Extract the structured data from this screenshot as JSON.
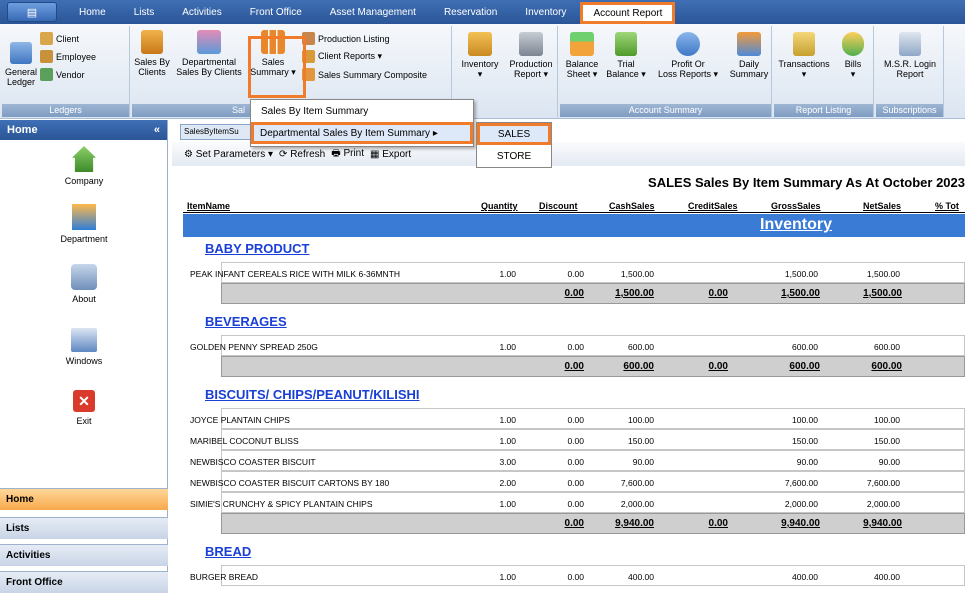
{
  "menubar": {
    "tabs": [
      "Home",
      "Lists",
      "Activities",
      "Front Office",
      "Asset Management",
      "Reservation",
      "Inventory"
    ],
    "active_tab": "Account Report"
  },
  "ribbon": {
    "ledgers": {
      "title": "Ledgers",
      "general": "General\nLedger",
      "client": "Client",
      "employee": "Employee",
      "vendor": "Vendor"
    },
    "sales": {
      "title": "Sal",
      "sales_by_clients": "Sales By\nClients",
      "departmental": "Departmental\nSales By Clients",
      "sales_summary": "Sales\nSummary ▾",
      "production_listing": "Production Listing",
      "client_reports": "Client Reports ▾",
      "sales_summary_composite": "Sales Summary Composite"
    },
    "inventory": {
      "inventory": "Inventory\n▾",
      "production": "Production\nReport ▾"
    },
    "account_summary": {
      "title": "Account Summary",
      "balance": "Balance\nSheet ▾",
      "trial": "Trial\nBalance ▾",
      "profit": "Profit Or\nLoss Reports ▾",
      "daily": "Daily\nSummary"
    },
    "report_listing": {
      "title": "Report Listing",
      "transactions": "Transactions\n▾",
      "bills": "Bills\n▾"
    },
    "subscriptions": {
      "title": "Subscriptions",
      "msr": "M.S.R. Login\nReport"
    }
  },
  "sidebar": {
    "title": "Home",
    "collapse": "«",
    "items": [
      "Company",
      "Department",
      "About",
      "Windows",
      "Exit"
    ],
    "nav": [
      "Home",
      "Lists",
      "Activities",
      "Front Office"
    ]
  },
  "doc": {
    "tab": "SalesByItemSu",
    "toolbar": {
      "set_parameters": "Set Parameters ▾",
      "refresh": "Refresh",
      "print": "Print",
      "export": "Export"
    }
  },
  "dropdown": {
    "items": [
      "Sales By Item Summary",
      "Departmental Sales By Item Summary  ▸"
    ]
  },
  "submenu": {
    "items": [
      "SALES",
      "STORE"
    ]
  },
  "report": {
    "title": "SALES Sales By Item Summary As At October 2023",
    "columns": [
      "ItemName",
      "Quantity",
      "Discount",
      "CashSales",
      "CreditSales",
      "GrossSales",
      "NetSales",
      "% Tot"
    ],
    "section": "Inventory",
    "categories": [
      {
        "name": "BABY PRODUCT",
        "rows": [
          [
            "PEAK INFANT CEREALS RICE WITH MILK 6-36MNTH",
            "1.00",
            "0.00",
            "1,500.00",
            "",
            "1,500.00",
            "1,500.00"
          ]
        ],
        "total": [
          "0.00",
          "1,500.00",
          "0.00",
          "1,500.00",
          "1,500.00"
        ]
      },
      {
        "name": "BEVERAGES",
        "rows": [
          [
            "GOLDEN PENNY SPREAD 250G",
            "1.00",
            "0.00",
            "600.00",
            "",
            "600.00",
            "600.00"
          ]
        ],
        "total": [
          "0.00",
          "600.00",
          "0.00",
          "600.00",
          "600.00"
        ]
      },
      {
        "name": "BISCUITS/ CHIPS/PEANUT/KILISHI",
        "rows": [
          [
            "JOYCE PLANTAIN CHIPS",
            "1.00",
            "0.00",
            "100.00",
            "",
            "100.00",
            "100.00"
          ],
          [
            "MARIBEL COCONUT BLISS",
            "1.00",
            "0.00",
            "150.00",
            "",
            "150.00",
            "150.00"
          ],
          [
            "NEWBISCO COASTER BISCUIT",
            "3.00",
            "0.00",
            "90.00",
            "",
            "90.00",
            "90.00"
          ],
          [
            "NEWBISCO COASTER BISCUIT  CARTONS BY 180",
            "2.00",
            "0.00",
            "7,600.00",
            "",
            "7,600.00",
            "7,600.00"
          ],
          [
            "SIMIE'S CRUNCHY & SPICY PLANTAIN CHIPS",
            "1.00",
            "0.00",
            "2,000.00",
            "",
            "2,000.00",
            "2,000.00"
          ]
        ],
        "total": [
          "0.00",
          "9,940.00",
          "0.00",
          "9,940.00",
          "9,940.00"
        ]
      },
      {
        "name": "BREAD",
        "rows": [
          [
            "BURGER BREAD",
            "1.00",
            "0.00",
            "400.00",
            "",
            "400.00",
            "400.00"
          ]
        ],
        "total": null
      }
    ]
  }
}
